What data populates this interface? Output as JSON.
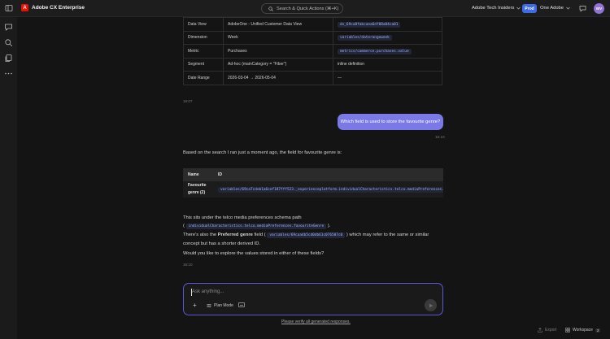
{
  "app": {
    "brand_name": "Adobe CX Enterprise",
    "brand_letter": "A"
  },
  "topbar": {
    "search_placeholder": "Search & Quick Actions (⌘+K)",
    "org_name": "Adobe Tech Insiders",
    "env_badge": "Prod",
    "tenant": "One Adobe",
    "avatar_initials": "WV"
  },
  "details_table": [
    {
      "label": "Data View",
      "value": "AdobeOne - Unified Customer Data View",
      "id": "dv_69ca8fabcaea6df08a04ca01"
    },
    {
      "label": "Dimension",
      "value": "Week",
      "id": "variables/daterangeweek"
    },
    {
      "label": "Metric",
      "value": "Purchases",
      "id": "metrics/commerce.purchases.value"
    },
    {
      "label": "Segment",
      "value": "Ad-hoc (mainCategory = \"Fiber\")",
      "id_text": "inline definition"
    },
    {
      "label": "Date Range",
      "value": "2026-03-04 → 2026-05-04",
      "id_text": "—"
    }
  ],
  "messages": {
    "time_1": "16:07",
    "user_question": "Which field is used to store the favourite genre?",
    "time_2": "16:10",
    "answer_intro": "Based on the search I ran just a moment ago, the field for favourite genre is:",
    "table_header_name": "Name",
    "table_header_id": "ID",
    "row_name": "Favourite genre (2)",
    "row_id": "variables/69ca7cdeb1a6cef187fff523._experienceplatform.individualCharacteristics.telco.mediaPreferences.favouriteGenre",
    "schema_line_1": "This sits under the telco media preferences schema path",
    "schema_paren_open": "(",
    "schema_path": "individualCharacteristics.telco.mediaPreferences.favouriteGenre",
    "schema_paren_close": ").",
    "also_prefix": "There's also the",
    "also_bold": "Preferred genre",
    "also_field": "field (",
    "also_id": "variables/69caa4b5cd0db61c076507c0",
    "also_suffix": ") which may refer to the same or similar",
    "also_line_2": "concept but has a shorter derived ID.",
    "followup": "Would you like to explore the values stored in either of these fields?",
    "time_3": "16:10"
  },
  "composer": {
    "placeholder": "Ask anything...",
    "plan_mode_label": "Plan Mode"
  },
  "footer": {
    "verify_link": "Please verify all generated responses.",
    "export_label": "Export",
    "workspace_label": "Workspace",
    "workspace_count": "2"
  },
  "colors": {
    "accent": "#7b79e8",
    "brand": "#eb1000",
    "prod_badge": "#3d6be6",
    "avatar": "#9173d6"
  }
}
